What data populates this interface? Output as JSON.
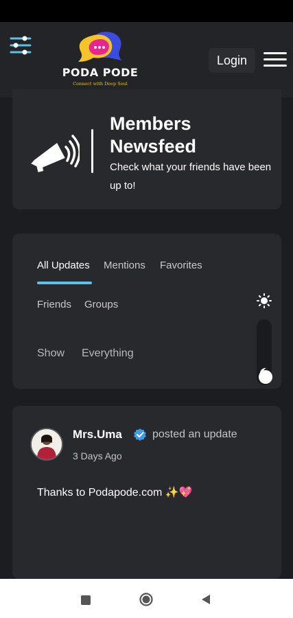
{
  "header": {
    "logo_title": "PODA PODE",
    "logo_tagline": "Connect with Deep Soul",
    "login_label": "Login",
    "icons": [
      "filter-icon",
      "menu-icon"
    ]
  },
  "newsfeed": {
    "title": "Members Newsfeed",
    "subtitle": "Check what your friends have been up to!",
    "icon": "megaphone-icon"
  },
  "tabs": {
    "primary": [
      {
        "label": "All Updates",
        "active": true
      },
      {
        "label": "Mentions",
        "active": false
      },
      {
        "label": "Favorites",
        "active": false
      }
    ],
    "secondary": [
      {
        "label": "Friends"
      },
      {
        "label": "Groups"
      }
    ],
    "show_label": "Show",
    "show_value": "Everything"
  },
  "theme_toggle": {
    "icons": [
      "sun-icon",
      "moon-icon"
    ],
    "mode": "dark"
  },
  "post": {
    "author": "Mrs.Uma",
    "action": "posted an update",
    "time": "3 Days Ago",
    "text": "Thanks to Podapode.com ✨💖",
    "verified_color": "#3d9be9"
  },
  "colors": {
    "accent": "#5cc1e8",
    "background": "#1c1d20",
    "card": "#28292d"
  }
}
